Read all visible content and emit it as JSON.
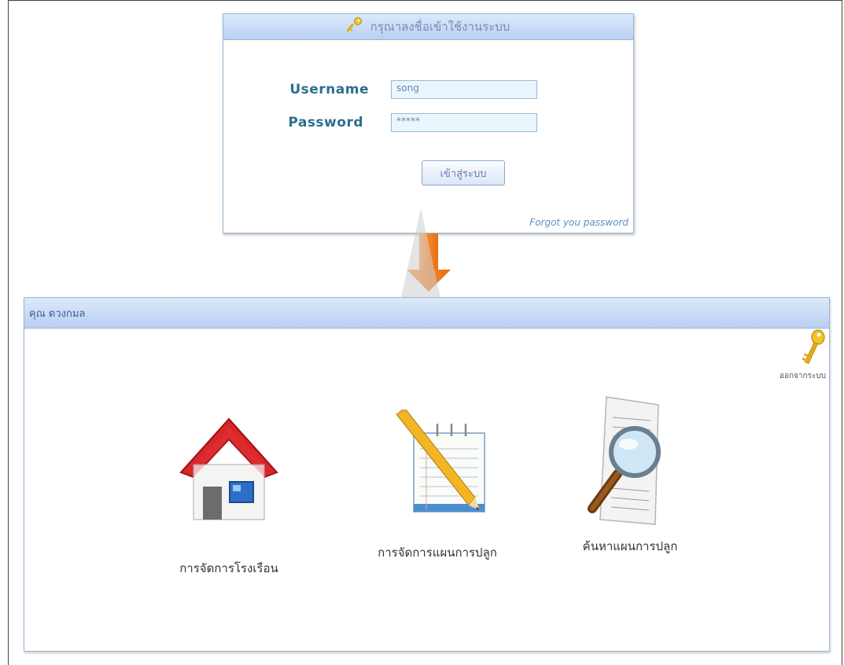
{
  "login": {
    "title": "กรุณาลงชื่อเข้าใช้งานระบบ",
    "username_label": "Username",
    "username_value": "song",
    "password_label": "Password",
    "password_value": "*****",
    "submit_label": "เข้าสู่ระบบ",
    "forgot_label": "Forgot you password"
  },
  "dashboard": {
    "user_name": "คุณ ดวงกมล",
    "logout_label": "ออกจากระบบ",
    "items": [
      {
        "label": "การจัดการโรงเรือน",
        "icon": "house-icon"
      },
      {
        "label": "การจัดการแผนการปลูก",
        "icon": "notepad-pencil-icon"
      },
      {
        "label": "ค้นหาแผนการปลูก",
        "icon": "document-search-icon"
      }
    ]
  },
  "colors": {
    "header_gradient_top": "#dce9fb",
    "header_gradient_bottom": "#b9d0f0",
    "label_blue": "#2d6f8e",
    "arrow_orange": "#f08a24"
  }
}
